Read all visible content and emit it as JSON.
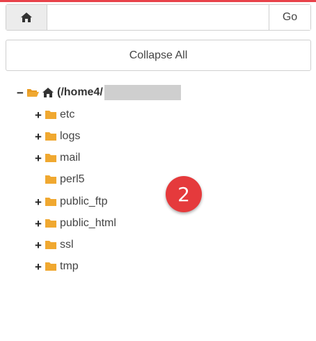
{
  "toolbar": {
    "home_icon": "home-icon",
    "path_value": "",
    "go_label": "Go"
  },
  "collapse_all_label": "Collapse All",
  "tree": {
    "root": {
      "toggle": "−",
      "label": "(/home4/",
      "icon": "open-folder-icon"
    },
    "items": [
      {
        "toggle": "+",
        "label": "etc"
      },
      {
        "toggle": "+",
        "label": "logs"
      },
      {
        "toggle": "+",
        "label": "mail"
      },
      {
        "toggle": "",
        "label": "perl5"
      },
      {
        "toggle": "+",
        "label": "public_ftp"
      },
      {
        "toggle": "+",
        "label": "public_html"
      },
      {
        "toggle": "+",
        "label": "ssl"
      },
      {
        "toggle": "+",
        "label": "tmp"
      }
    ]
  },
  "annotation_badge": "2",
  "colors": {
    "accent": "#e8424a",
    "folder": "#f0a830",
    "badge": "#e53a3c"
  }
}
